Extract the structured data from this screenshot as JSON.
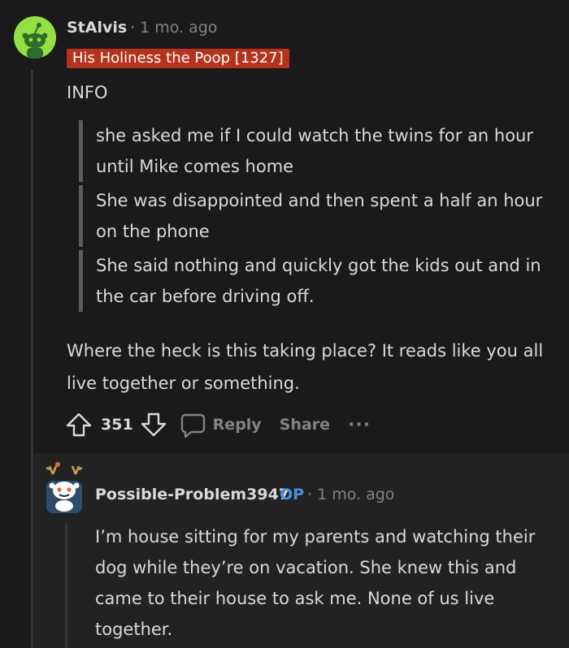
{
  "comment": {
    "username": "StAlvis",
    "meta": "· 1 mo. ago",
    "flair": "His Holiness the Poop [1327]",
    "heading": "INFO",
    "quotes": [
      "she asked me if I could watch the twins for an hour until Mike comes home",
      "She was disappointed and then spent a half an hour on the phone",
      "She said nothing and quickly got the kids out and in the car before driving off."
    ],
    "body": "Where the heck is this taking place? It reads like you all live together or something.",
    "score": "351",
    "reply_label": "Reply",
    "share_label": "Share",
    "more_label": "···",
    "avatar_color": "#94e044",
    "flair_color": "#b5331c"
  },
  "reply": {
    "username": "Possible-Problem3947",
    "op_badge": "OP",
    "meta": "· 1 mo. ago",
    "body": "I’m house sitting for my parents and watching their dog while they’re on vacation. She knew this and came to their house to ask me. None of us live together.",
    "op_color": "#4a8fdf"
  }
}
